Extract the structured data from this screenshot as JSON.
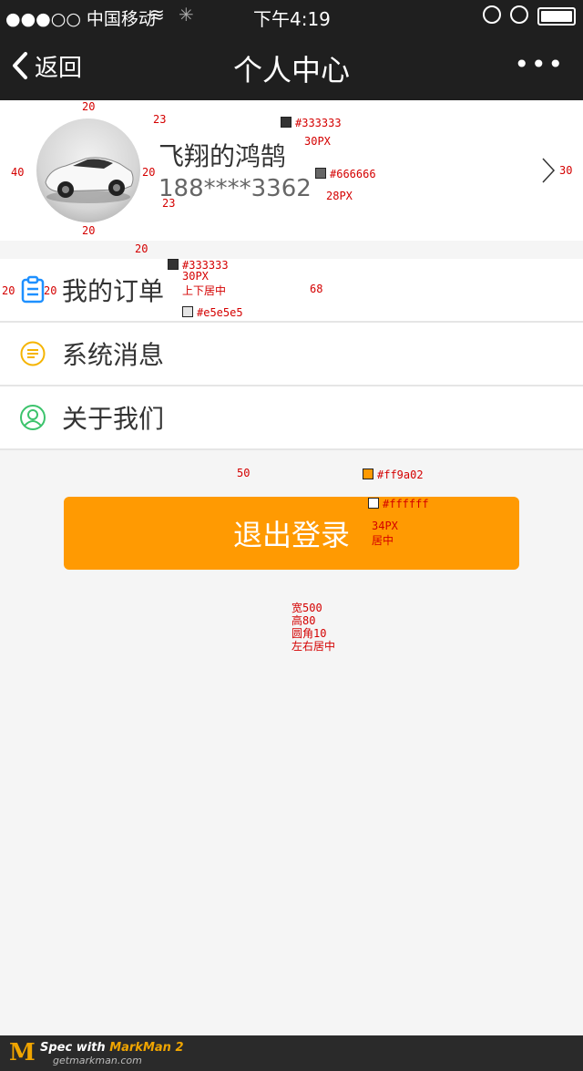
{
  "status_bar": {
    "carrier": "●●●○○ 中国移动",
    "time": "下午4:19"
  },
  "nav": {
    "back_label": "返回",
    "title": "个人中心",
    "more": "•••"
  },
  "profile": {
    "name": "飞翔的鸿鹄",
    "phone": "188****3362"
  },
  "menu": {
    "items": [
      {
        "label": "我的订单",
        "icon": "clipboard-icon",
        "color": "#1e90ff"
      },
      {
        "label": "系统消息",
        "icon": "message-icon",
        "color": "#f5b400"
      },
      {
        "label": "关于我们",
        "icon": "user-icon",
        "color": "#3cc36c"
      }
    ]
  },
  "logout": {
    "label": "退出登录"
  },
  "annotations": {
    "nav_w20_top": "20",
    "profile_40": "40",
    "profile_20_left": "20",
    "profile_20_bottom": "20",
    "name_gap_23a": "23",
    "name_gap_23b": "23",
    "name_color": "#333333",
    "name_size": "30PX",
    "phone_color": "#666666",
    "phone_size": "28PX",
    "arrow_30": "30",
    "menu_gap_20": "20",
    "menu_color": "#333333",
    "menu_size": "30PX",
    "menu_align": "上下居中",
    "divider_color": "#e5e5e5",
    "row_height": "68",
    "menu_left_20a": "20",
    "menu_left_20b": "20",
    "btn_gap_50": "50",
    "btn_bg": "#ff9a02",
    "btn_text_color": "#ffffff",
    "btn_text_size": "34PX",
    "btn_text_align": "居中",
    "btn_w": "宽500",
    "btn_h": "高80",
    "btn_r": "圆角10",
    "btn_align": "左右居中"
  },
  "footer": {
    "brand_prefix": "Spec with ",
    "brand": "MarkMan 2",
    "url": "getmarkman.com"
  }
}
